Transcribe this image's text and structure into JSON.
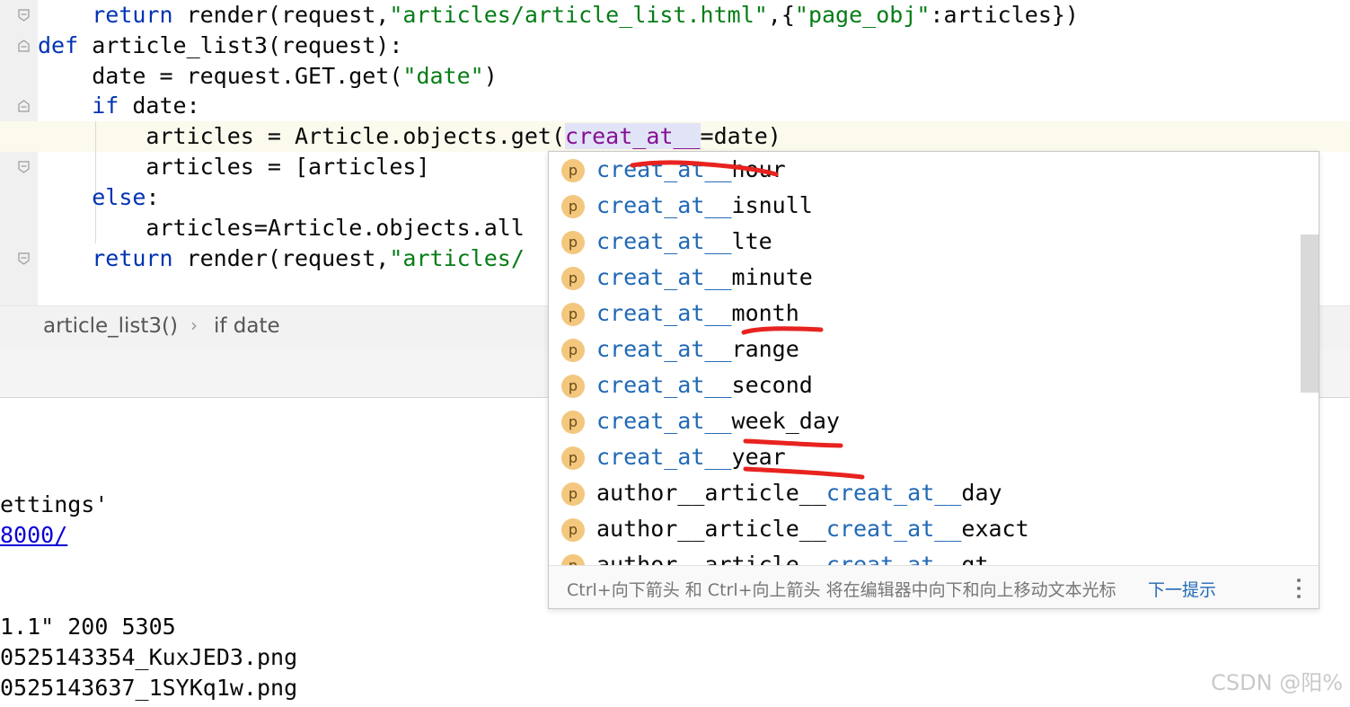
{
  "editor": {
    "lines": [
      {
        "indent": "    ",
        "kw": "return",
        "rest": " render(request,",
        "str": "\"articles/article_list.html\"",
        "tail": ",{",
        "str2": "\"page_obj\"",
        "tail2": ":articles})"
      },
      {
        "kw": "def",
        "rest": " article_list3(request):"
      },
      {
        "indent": "    ",
        "pre": "date = request.GET.get(",
        "str": "\"date\"",
        "tail": ")"
      },
      {
        "indent": "    ",
        "kw": "if",
        "rest": " date:"
      },
      {
        "indent": "        ",
        "pre": "articles = Article.objects.get(",
        "param": "creat_at__",
        "tail": "=date)"
      },
      {
        "indent": "        ",
        "pre": "articles = [articles]"
      },
      {
        "indent": "    ",
        "kw": "else",
        "rest": ":"
      },
      {
        "indent": "        ",
        "pre": "articles=Article.objects.all"
      },
      {
        "indent": "    ",
        "kw": "return",
        "rest": " render(request,",
        "str": "\"articles/"
      }
    ]
  },
  "breadcrumb": {
    "items": [
      "article_list3()",
      "if date"
    ],
    "separator": "›"
  },
  "console": {
    "lines": [
      {
        "text": "ettings'"
      },
      {
        "link": "8000/"
      },
      {
        "text": "1.1\" 200 5305"
      },
      {
        "text": "0525143354_KuxJED3.png"
      },
      {
        "text": "0525143637_1SYKq1w.png"
      }
    ]
  },
  "completion": {
    "badge": "p",
    "items": [
      {
        "match": "creat_at__",
        "rest": "hour"
      },
      {
        "match": "creat_at__",
        "rest": "isnull"
      },
      {
        "match": "creat_at__",
        "rest": "lte"
      },
      {
        "match": "creat_at__",
        "rest": "minute"
      },
      {
        "match": "creat_at__",
        "rest": "month"
      },
      {
        "match": "creat_at__",
        "rest": "range"
      },
      {
        "match": "creat_at__",
        "rest": "second"
      },
      {
        "match": "creat_at__",
        "rest": "week_day"
      },
      {
        "match": "creat_at__",
        "rest": "year"
      },
      {
        "pre": "author__article__",
        "match": "creat_at__",
        "rest": "day"
      },
      {
        "pre": "author__article__",
        "match": "creat_at__",
        "rest": "exact"
      },
      {
        "pre": "author__article__",
        "match": "creat_at__",
        "rest": "gt"
      }
    ],
    "footer_hint": "Ctrl+向下箭头 和 Ctrl+向上箭头 将在编辑器中向下和向上移动文本光标",
    "footer_link": "下一提示",
    "more_icon": "vertical-ellipsis-icon"
  },
  "watermark": "CSDN @阳%",
  "colors": {
    "keyword": "#0033b3",
    "string": "#067d17",
    "parameter": "#871094",
    "match": "#2169b5",
    "badge": "#f3c77d",
    "annotation": "#e8231f"
  }
}
